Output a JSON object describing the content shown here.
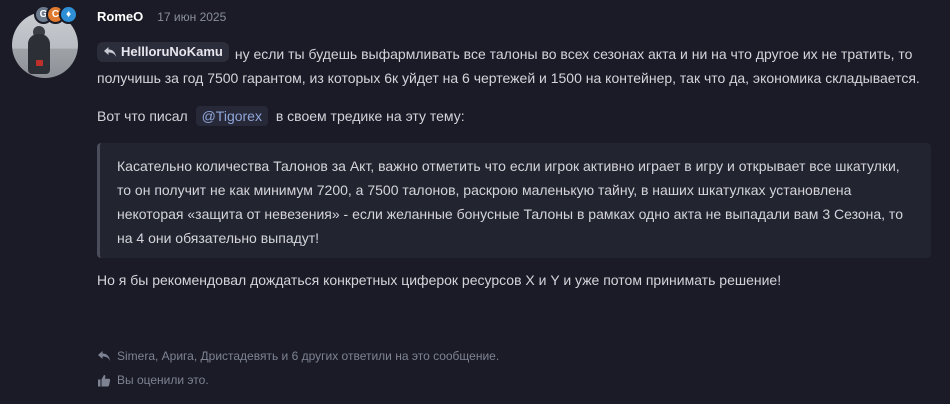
{
  "post": {
    "author": "RomeO",
    "date": "17 июн 2025",
    "badges": [
      "G",
      "C",
      "♦"
    ],
    "reply_to": "HellloruNoKamu",
    "paragraph1": "ну если ты будешь выфармливать все талоны во всех сезонах акта и ни на что другое их не тратить, то получишь за год 7500 гарантом, из которых 6к уйдет на 6 чертежей и 1500 на контейнер, так что да, экономика складывается.",
    "p2_before": "Вот что писал",
    "p2_mention": "@Tigorex",
    "p2_after": "в своем тредике на эту тему:",
    "quote": "Касательно количества Талонов за Акт, важно отметить что если игрок активно играет в игру и открывает все шкатулки, то он получит не как минимум 7200, а 7500 талонов, раскрою маленькую тайну, в наших шкатулках установлена некоторая «защита от невезения» - если желанные бонусные Талоны в рамках одно акта не выпадали вам 3 Сезона, то на 4 они обязательно выпадут!",
    "paragraph4": "Но я бы рекомендовал дождаться конкретных циферок ресурсов X и Y и уже потом принимать решение!",
    "replies_text": "Simera, Арига, Дристадевять и 6 других ответили на это сообщение.",
    "reaction_text": "Вы оценили это."
  },
  "colors": {
    "background": "#1a1b26",
    "quote_bg": "#22242f",
    "mention_color": "#8fa6d8"
  },
  "icons": {
    "reply": "reply-arrow-icon",
    "like": "thumbs-up-icon"
  }
}
